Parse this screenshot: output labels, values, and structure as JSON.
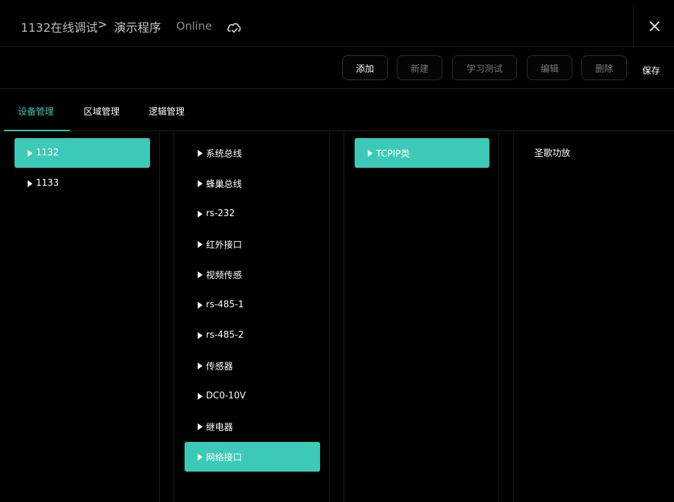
{
  "header": {
    "path": "1132在线调试",
    "separator": ">",
    "program": "演示程序",
    "status": "Online"
  },
  "toolbar": {
    "add": "添加",
    "new": "新建",
    "learn_test": "学习测试",
    "edit": "编辑",
    "delete": "删除",
    "save": "保存"
  },
  "tabs": {
    "device": "设备管理",
    "area": "区域管理",
    "logic": "逻辑管理"
  },
  "columns": {
    "devices": [
      "1132",
      "1133"
    ],
    "buses": [
      "系统总线",
      "蜂巢总线",
      "rs-232",
      "红外接口",
      "视频传感",
      "rs-485-1",
      "rs-485-2",
      "传感器",
      "DC0-10V",
      "继电器",
      "网络接口"
    ],
    "types": [
      "TCPIP类"
    ],
    "items": [
      "圣歌功放"
    ]
  },
  "colors": {
    "accent": "#3cc9b8",
    "background": "#000000"
  }
}
